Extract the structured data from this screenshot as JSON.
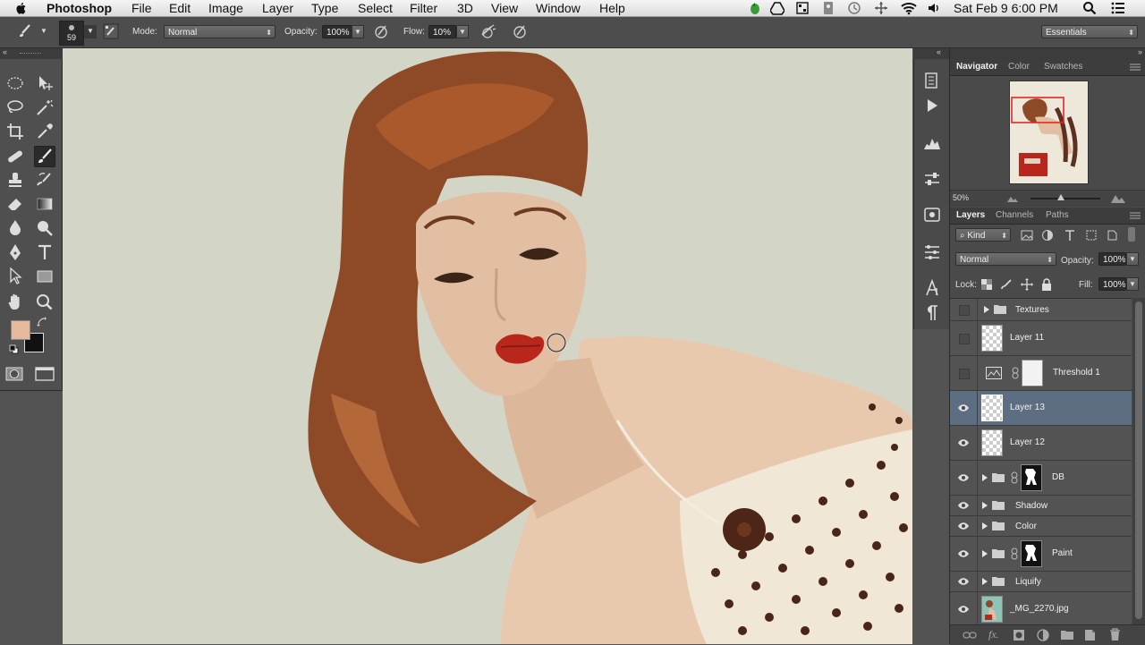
{
  "menubar": {
    "app_name": "Photoshop",
    "menus": [
      "File",
      "Edit",
      "Image",
      "Layer",
      "Type",
      "Select",
      "Filter",
      "3D",
      "View",
      "Window",
      "Help"
    ],
    "clock": "Sat Feb 9  6:00 PM"
  },
  "options_bar": {
    "brush_size": "59",
    "mode_label": "Mode:",
    "mode_value": "Normal",
    "opacity_label": "Opacity:",
    "opacity_value": "100%",
    "flow_label": "Flow:",
    "flow_value": "10%",
    "workspace": "Essentials"
  },
  "colors": {
    "foreground": "#e6b89c",
    "background": "#111111",
    "canvas_bg": "#d3d6c7",
    "selected_layer": "#5d6e82"
  },
  "navigator": {
    "tabs": [
      "Navigator",
      "Color",
      "Swatches"
    ],
    "zoom": "50%"
  },
  "layers_panel": {
    "tabs": [
      "Layers",
      "Channels",
      "Paths"
    ],
    "filter_kind": "Kind",
    "blend_mode": "Normal",
    "opacity_label": "Opacity:",
    "opacity_value": "100%",
    "lock_label": "Lock:",
    "fill_label": "Fill:",
    "fill_value": "100%",
    "layers": [
      {
        "name": "Textures",
        "kind": "group",
        "visible": false
      },
      {
        "name": "Layer 11",
        "kind": "pixel",
        "visible": false
      },
      {
        "name": "Threshold 1",
        "kind": "adjustment",
        "visible": false
      },
      {
        "name": "Layer 13",
        "kind": "pixel",
        "visible": true,
        "selected": true
      },
      {
        "name": "Layer 12",
        "kind": "pixel",
        "visible": true
      },
      {
        "name": "DB",
        "kind": "group-mask",
        "visible": true
      },
      {
        "name": "Shadow",
        "kind": "group",
        "visible": true
      },
      {
        "name": "Color",
        "kind": "group",
        "visible": true
      },
      {
        "name": "Paint",
        "kind": "group-mask",
        "visible": true
      },
      {
        "name": "Liquify",
        "kind": "group",
        "visible": true
      },
      {
        "name": "_MG_2270.jpg",
        "kind": "image",
        "visible": true
      }
    ]
  }
}
